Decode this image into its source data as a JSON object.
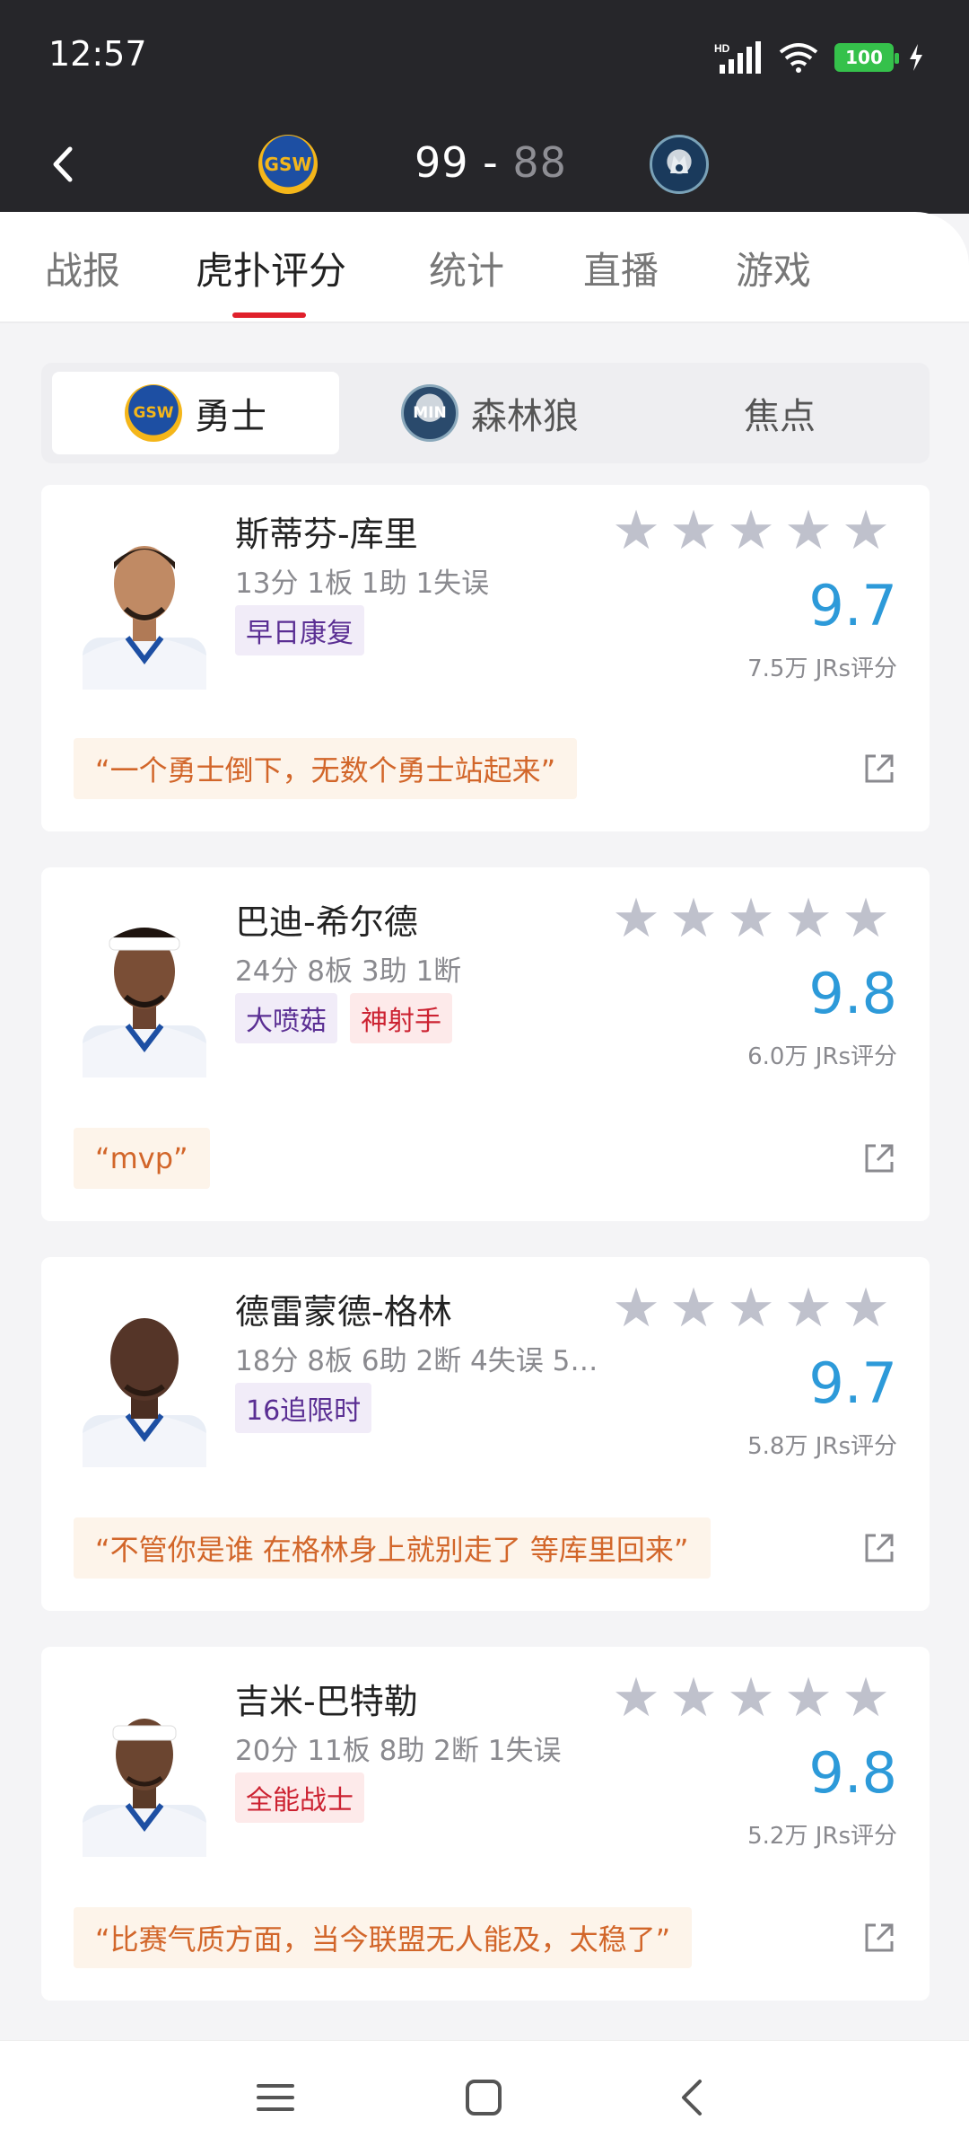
{
  "status_bar": {
    "time": "12:57",
    "battery": "100",
    "network": "HD"
  },
  "header": {
    "home_score": "99",
    "separator": "-",
    "away_score": "88",
    "home_team_logo": "GSW",
    "away_team_logo": "MIN"
  },
  "tabs": [
    {
      "label": "战报",
      "active": false
    },
    {
      "label": "虎扑评分",
      "active": true
    },
    {
      "label": "统计",
      "active": false
    },
    {
      "label": "直播",
      "active": false
    },
    {
      "label": "游戏",
      "active": false
    }
  ],
  "segments": [
    {
      "label": "勇士",
      "logo": "GSW",
      "active": true
    },
    {
      "label": "森林狼",
      "logo": "MIN",
      "active": false
    },
    {
      "label": "焦点",
      "active": false
    }
  ],
  "players": [
    {
      "name": "斯蒂芬-库里",
      "stats": "13分 1板 1助 1失误",
      "tags": [
        {
          "text": "早日康复",
          "style": "purple"
        }
      ],
      "rating": "9.7",
      "votes": "7.5万 JRs评分",
      "quote": "“一个勇士倒下，无数个勇士站起来”"
    },
    {
      "name": "巴迪-希尔德",
      "stats": "24分 8板 3助 1断",
      "tags": [
        {
          "text": "大喷菇",
          "style": "purple"
        },
        {
          "text": "神射手",
          "style": "red"
        }
      ],
      "rating": "9.8",
      "votes": "6.0万 JRs评分",
      "quote": "“mvp”"
    },
    {
      "name": "德雷蒙德-格林",
      "stats": "18分 8板 6助 2断 4失误 5…",
      "tags": [
        {
          "text": "16追限时",
          "style": "purple"
        }
      ],
      "rating": "9.7",
      "votes": "5.8万 JRs评分",
      "quote": "“不管你是谁 在格林身上就别走了 等库里回来”"
    },
    {
      "name": "吉米-巴特勒",
      "stats": "20分 11板 8助 2断 1失误",
      "tags": [
        {
          "text": "全能战士",
          "style": "red"
        }
      ],
      "rating": "9.8",
      "votes": "5.2万 JRs评分",
      "quote": "“比赛气质方面，当今联盟无人能及，太稳了”"
    }
  ],
  "colors": {
    "header_bg": "#26262a",
    "accent_red": "#e0202b",
    "rating_blue": "#2d9ad9",
    "quote_orange": "#d2662a",
    "star_gray": "#bfc1cc"
  },
  "icons": {
    "back": "chevron-left-icon",
    "share": "share-icon",
    "star": "star-icon",
    "menu": "menu-icon",
    "home": "home-square-icon"
  }
}
